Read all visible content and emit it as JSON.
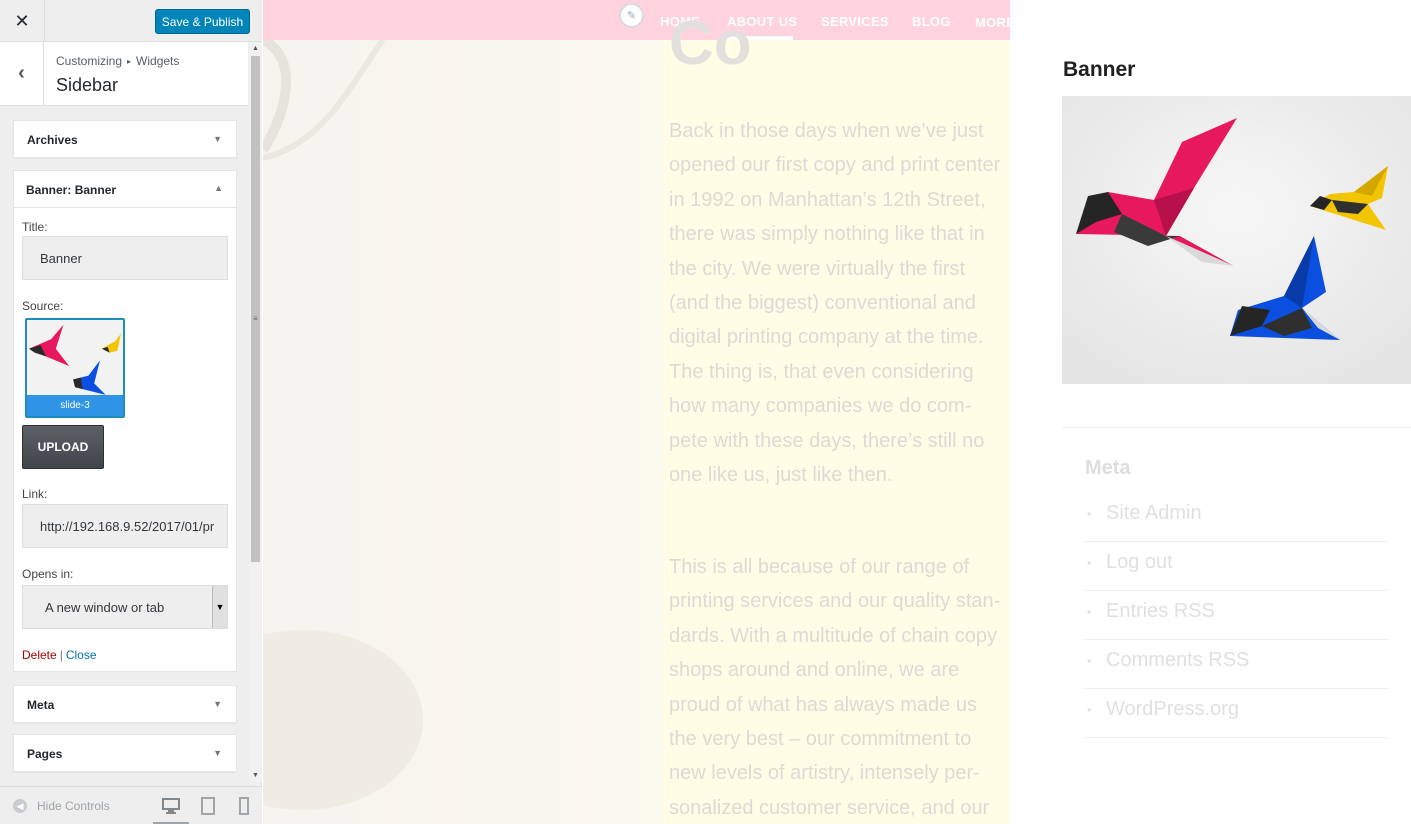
{
  "customizer": {
    "close_glyph": "✕",
    "save_label": "Save & Publish",
    "breadcrumb": [
      "Customizing",
      "Widgets"
    ],
    "breadcrumb_sep": "▸",
    "section_title": "Sidebar",
    "widgets": {
      "archives": "Archives",
      "banner": {
        "title_prefix": "Banner:",
        "title_sub": "Banner",
        "title_label": "Title:",
        "title_value": "Banner",
        "source_label": "Source:",
        "source_caption": "slide-3",
        "upload_label": "UPLOAD",
        "link_label": "Link:",
        "link_value": "http://192.168.9.52/2017/01/pr",
        "opens_label": "Opens in:",
        "opens_value": "A new window or tab",
        "delete_label": "Delete",
        "close_label": "Close"
      },
      "meta": "Meta",
      "pages": "Pages"
    },
    "footer": {
      "hide_controls": "Hide Controls"
    },
    "colors": {
      "accent": "#0085ba",
      "delete": "#aa0000",
      "link": "#0073aa"
    }
  },
  "preview": {
    "nav": [
      "HOME",
      "ABOUT US",
      "SERVICES",
      "BLOG",
      "MORE"
    ],
    "active_nav": "ABOUT US",
    "hero_heading": "Co",
    "hero_lines_1": [
      "Back in those days when we’ve just",
      "opened our first copy and print center",
      "in 1992 on Manhattan’s 12th Street,",
      "there was simply nothing like that in",
      "the city. We were virtually the first",
      "(and the biggest) conventional and",
      "digital printing company at the time.",
      "The thing is, that even considering",
      "how many companies we do com-",
      "pete with these days, there’s still no",
      "one like us, just like then."
    ],
    "hero_lines_2": [
      "This is all because of our range of",
      "printing services and our quality stan-",
      "dards. With a multitude of chain copy",
      "shops around and online, we are",
      "proud of what has always made us",
      "the very best – our commitment to",
      "new levels of artistry, intensely per-",
      "sonalized customer service, and our"
    ],
    "banner_heading": "Banner",
    "meta_heading": "Meta",
    "meta_links": [
      "Site Admin",
      "Log out",
      "Entries RSS",
      "Comments RSS",
      "WordPress.org"
    ],
    "colors": {
      "nav_bg": "#ffd3de",
      "bird_pink": "#e8185f",
      "bird_yellow": "#f2c500",
      "bird_blue": "#0b4fe0"
    }
  }
}
